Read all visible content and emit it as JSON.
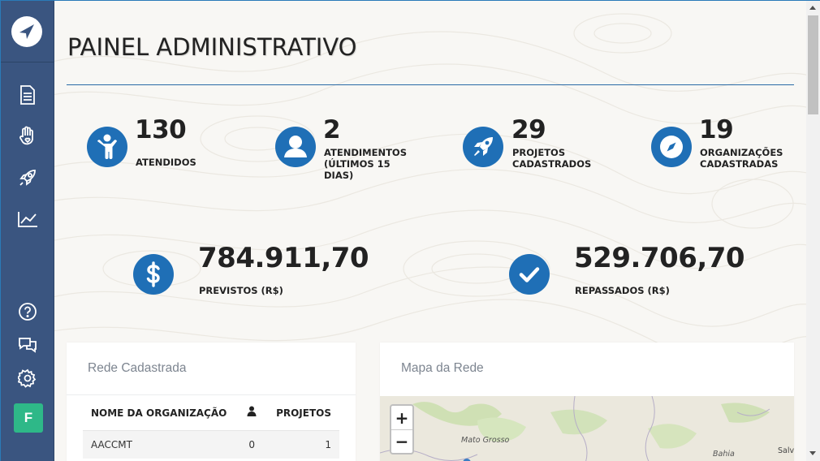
{
  "page": {
    "title": "PAINEL ADMINISTRATIVO"
  },
  "user": {
    "initial": "F"
  },
  "stats": [
    {
      "value": "130",
      "label": "ATENDIDOS",
      "icon": "person-icon"
    },
    {
      "value": "2",
      "label": "ATENDIMENTOS (ÚLTIMOS 15 DIAS)",
      "icon": "user-icon"
    },
    {
      "value": "29",
      "label": "PROJETOS CADASTRADOS",
      "icon": "rocket-icon"
    },
    {
      "value": "19",
      "label": "ORGANIZAÇÕES CADASTRADAS",
      "icon": "compass-icon"
    }
  ],
  "money": [
    {
      "value": "784.911,70",
      "label": "PREVISTOS (R$)",
      "icon": "dollar-icon"
    },
    {
      "value": "529.706,70",
      "label": "REPASSADOS (R$)",
      "icon": "check-icon"
    }
  ],
  "network_card": {
    "title": "Rede Cadastrada",
    "columns": [
      "NOME DA ORGANIZAÇÃO",
      "",
      "PROJETOS"
    ],
    "rows": [
      {
        "name": "AACCMT",
        "people": "0",
        "projects": "1"
      }
    ]
  },
  "map_card": {
    "title": "Mapa da Rede",
    "zoom_in": "+",
    "zoom_out": "−",
    "labels": [
      "Mato Grosso",
      "Bahia",
      "Salv"
    ]
  },
  "colors": {
    "sidebar": "#3a5580",
    "accent": "#1f6fb6",
    "avatar": "#2eb888"
  }
}
